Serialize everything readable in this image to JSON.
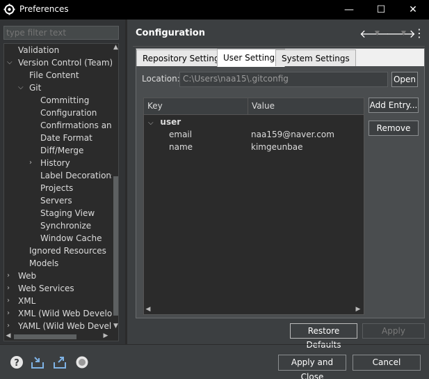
{
  "window": {
    "title": "Preferences",
    "minimize_glyph": "—",
    "maximize_glyph": "☐",
    "close_glyph": "✕"
  },
  "sidebar": {
    "filter_placeholder": "type filter text",
    "items": [
      {
        "label": "Validation"
      },
      {
        "label": "Version Control (Team)"
      },
      {
        "label": "File Content"
      },
      {
        "label": "Git"
      },
      {
        "label": "Committing"
      },
      {
        "label": "Configuration"
      },
      {
        "label": "Confirmations and"
      },
      {
        "label": "Date Format"
      },
      {
        "label": "Diff/Merge"
      },
      {
        "label": "History"
      },
      {
        "label": "Label Decorations"
      },
      {
        "label": "Projects"
      },
      {
        "label": "Servers"
      },
      {
        "label": "Staging View"
      },
      {
        "label": "Synchronize"
      },
      {
        "label": "Window Cache"
      },
      {
        "label": "Ignored Resources"
      },
      {
        "label": "Models"
      },
      {
        "label": "Web"
      },
      {
        "label": "Web Services"
      },
      {
        "label": "XML"
      },
      {
        "label": "XML (Wild Web Develop"
      },
      {
        "label": "YAML (Wild Web Develo"
      }
    ]
  },
  "page": {
    "title": "Configuration",
    "tabs": [
      {
        "label": "Repository Settings"
      },
      {
        "label": "User Settings"
      },
      {
        "label": "System Settings"
      }
    ],
    "location_label": "Location:",
    "location_value": "C:\\Users\\naa15\\.gitconfig",
    "open_label": "Open",
    "table": {
      "col_key": "Key",
      "col_value": "Value",
      "section": "user",
      "rows": [
        {
          "key": "email",
          "value": "naa159@naver.com"
        },
        {
          "key": "name",
          "value": "kimgeunbae"
        }
      ]
    },
    "add_entry_label": "Add Entry...",
    "remove_label": "Remove",
    "restore_defaults_label": "Restore Defaults",
    "apply_label": "Apply"
  },
  "footer": {
    "apply_close_label": "Apply and Close",
    "cancel_label": "Cancel"
  },
  "colors": {
    "background": "#3c3f41",
    "titlebar": "#000000",
    "tree_bg": "#2b2b2b"
  }
}
